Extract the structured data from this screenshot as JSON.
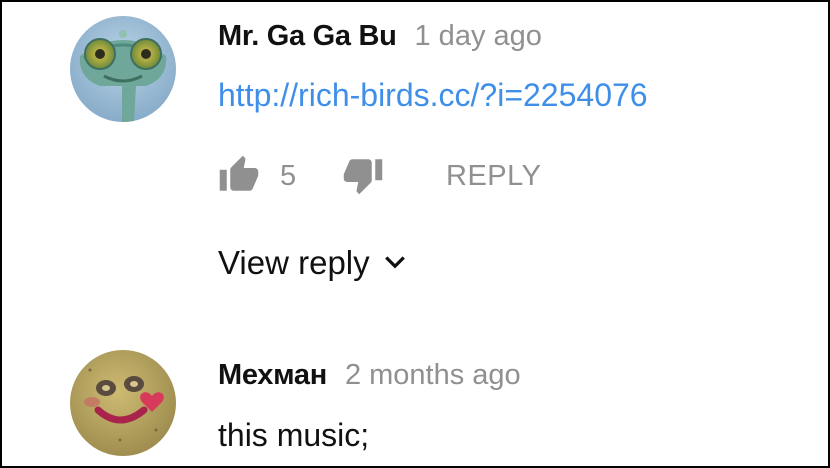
{
  "comments": [
    {
      "author": "Mr. Ga Ga Bu",
      "time": "1 day ago",
      "text": "http://rich-birds.cc/?i=2254076",
      "is_link": true,
      "avatar_icon": "chameleon-avatar",
      "likes": "5",
      "reply_label": "REPLY",
      "view_reply_label": "View reply"
    },
    {
      "author": "Мехман",
      "time": "2 months ago",
      "text": "this music;",
      "is_link": false,
      "avatar_icon": "smiley-avatar"
    }
  ],
  "colors": {
    "author": "#111111",
    "timestamp": "#909090",
    "link": "#3f8fe8",
    "action_gray": "#909090"
  },
  "icons": {
    "like": "thumbs-up-icon",
    "dislike": "thumbs-down-icon",
    "expand": "chevron-down-icon"
  }
}
